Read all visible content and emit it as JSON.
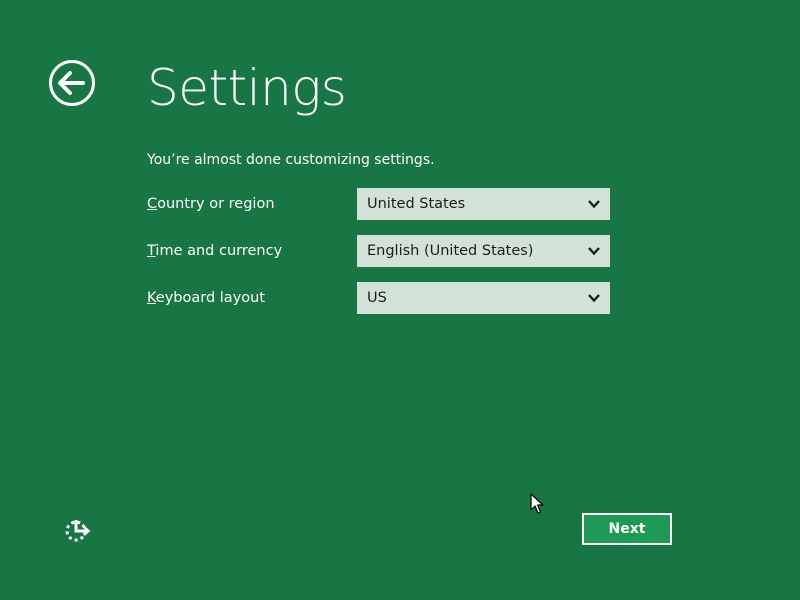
{
  "header": {
    "title": "Settings",
    "back_icon": "arrow-left-circle-icon"
  },
  "subtitle": "You’re almost done customizing settings.",
  "settings": [
    {
      "label_mnemonic": "C",
      "label_rest": "ountry or region",
      "value": "United States"
    },
    {
      "label_mnemonic": "T",
      "label_rest": "ime and currency",
      "value": "English (United States)"
    },
    {
      "label_mnemonic": "K",
      "label_rest": "eyboard layout",
      "value": "US"
    }
  ],
  "footer": {
    "ease_of_access_icon": "ease-of-access-icon",
    "next_label": "Next"
  },
  "colors": {
    "background": "#187544",
    "select_background": "#d3e2d9",
    "button_background": "#1f9a56",
    "text": "#ffffff"
  }
}
